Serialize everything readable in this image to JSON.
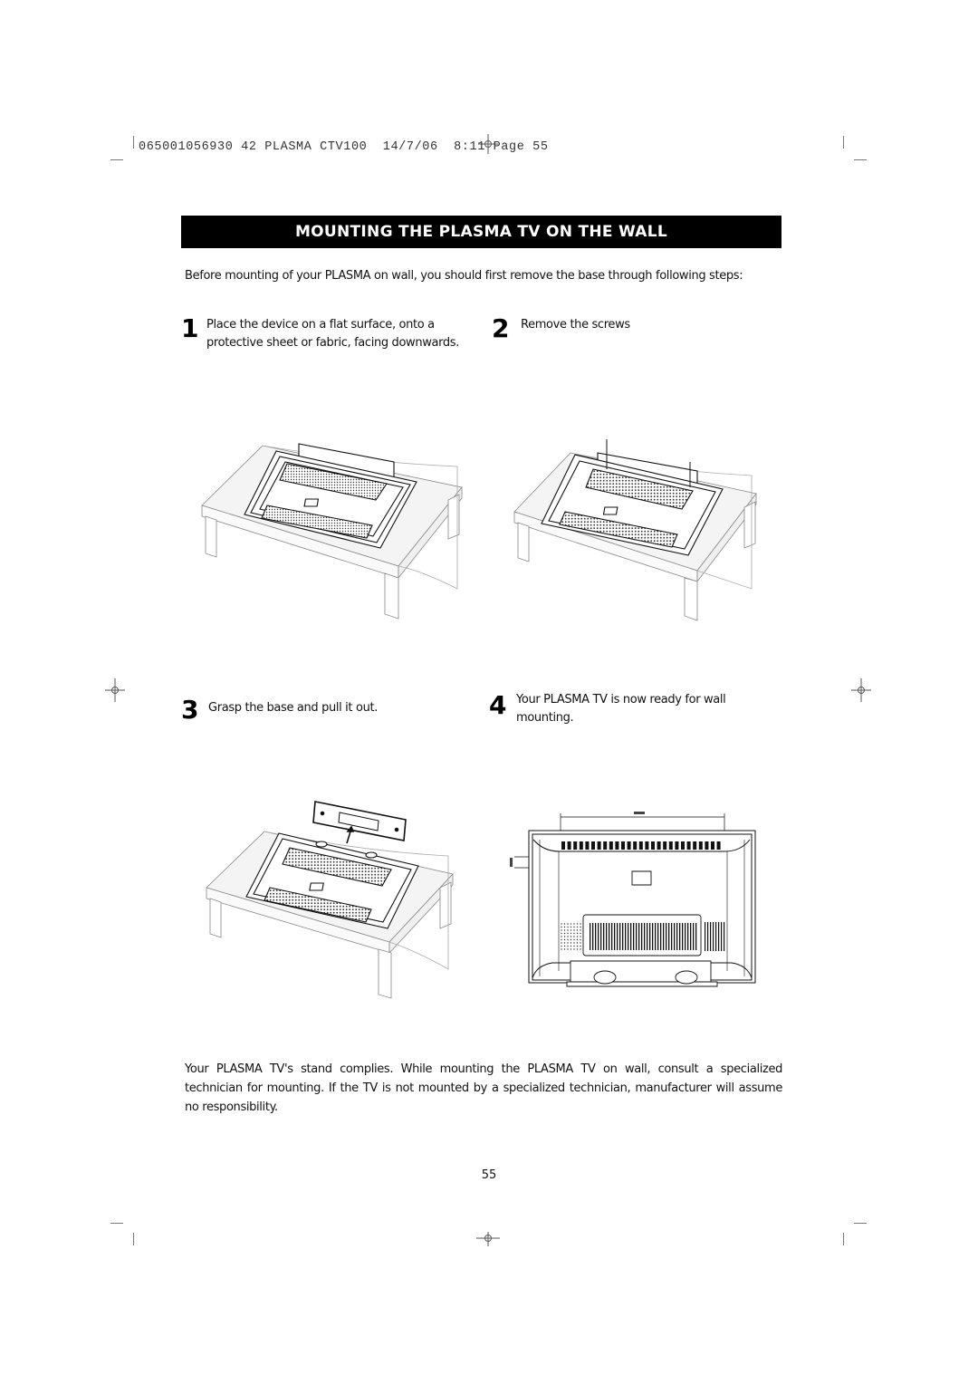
{
  "print_slug": {
    "job_number": "065001056930",
    "job_title": "42 PLASMA CTV100",
    "date": "14/7/06",
    "time": "8:11",
    "page_label": "Page 55"
  },
  "section": {
    "title": "MOUNTING THE PLASMA TV ON THE WALL",
    "intro": "Before mounting of your PLASMA on wall, you should first remove the base through following steps:"
  },
  "steps": [
    {
      "number": "1",
      "text": "Place the device on a flat surface, onto a protective sheet or fabric, facing downwards.",
      "illustration": "tv-face-down-on-table"
    },
    {
      "number": "2",
      "text": "Remove the screws",
      "illustration": "tv-screws-removed"
    },
    {
      "number": "3",
      "text": "Grasp the base and pull  it out.",
      "illustration": "tv-base-pulled-out"
    },
    {
      "number": "4",
      "text": "Your PLASMA TV is now ready for wall mounting.",
      "illustration": "tv-rear-view-wall-ready"
    }
  ],
  "disclaimer": "Your PLASMA TV's stand complies. While  mounting  the PLASMA TV on wall, consult a specialized technician for  mounting. If  the  TV is not mounted by a specialized technician, manufacturer will assume no  responsibility.",
  "page_number": "55",
  "icons": {
    "registration_mark": "crosshair-circle",
    "crop_mark": "line"
  }
}
